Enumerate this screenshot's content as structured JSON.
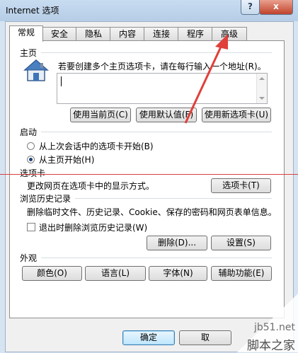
{
  "window": {
    "title": "Internet 选项",
    "help_label": "?",
    "close_label": "x"
  },
  "tabs": [
    {
      "label": "常规"
    },
    {
      "label": "安全"
    },
    {
      "label": "隐私"
    },
    {
      "label": "内容"
    },
    {
      "label": "连接"
    },
    {
      "label": "程序"
    },
    {
      "label": "高级"
    }
  ],
  "home": {
    "label": "主页",
    "description": "若要创建多个主页选项卡，请在每行输入一个地址(R)。",
    "value": "",
    "buttons": {
      "current": "使用当前页(C)",
      "default": "使用默认值(F)",
      "new_tab": "使用新选项卡(U)"
    }
  },
  "startup": {
    "label": "启动",
    "options": [
      {
        "label": "从上次会话中的选项卡开始(B)",
        "checked": false
      },
      {
        "label": "从主页开始(H)",
        "checked": true
      }
    ]
  },
  "tabs_section": {
    "label": "选项卡",
    "description": "更改网页在选项卡中的显示方式。",
    "button": "选项卡(T)"
  },
  "history": {
    "label": "浏览历史记录",
    "description": "删除临时文件、历史记录、Cookie、保存的密码和网页表单信息。",
    "checkbox_label": "退出时删除浏览历史记录(W)",
    "checkbox_checked": false,
    "delete_button": "删除(D)...",
    "settings_button": "设置(S)"
  },
  "appearance": {
    "label": "外观",
    "buttons": {
      "colors": "颜色(O)",
      "languages": "语言(L)",
      "fonts": "字体(N)",
      "accessibility": "辅助功能(E)"
    }
  },
  "footer": {
    "ok": "确定",
    "cancel": "取"
  },
  "watermark": {
    "site": "jb51.net",
    "name": "脚本之家"
  },
  "colors": {
    "annotation": "#e0403a",
    "accent": "#3c7fb1"
  }
}
